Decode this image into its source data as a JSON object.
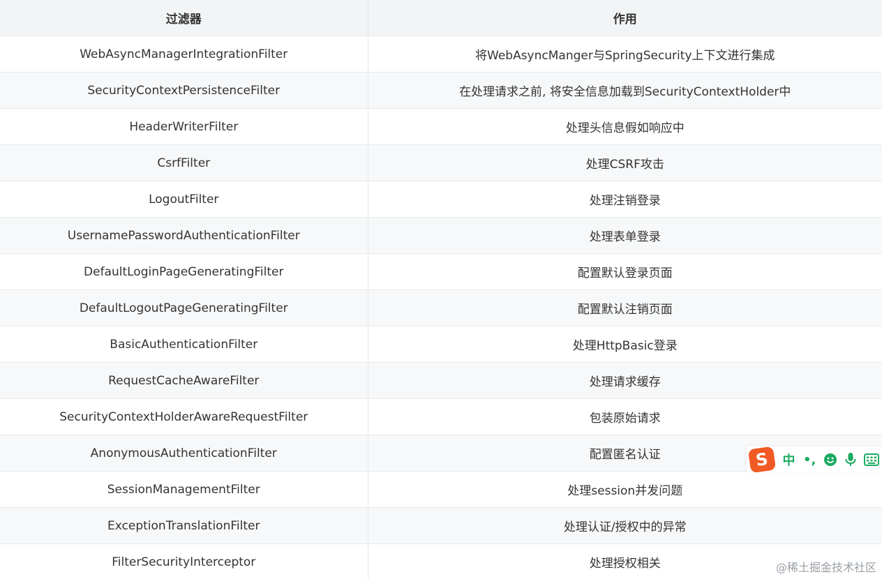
{
  "table": {
    "headers": [
      "过滤器",
      "作用"
    ],
    "rows": [
      [
        "WebAsyncManagerIntegrationFilter",
        "将WebAsyncManger与SpringSecurity上下文进行集成"
      ],
      [
        "SecurityContextPersistenceFilter",
        "在处理请求之前, 将安全信息加载到SecurityContextHolder中"
      ],
      [
        "HeaderWriterFilter",
        "处理头信息假如响应中"
      ],
      [
        "CsrfFilter",
        "处理CSRF攻击"
      ],
      [
        "LogoutFilter",
        "处理注销登录"
      ],
      [
        "UsernamePasswordAuthenticationFilter",
        "处理表单登录"
      ],
      [
        "DefaultLoginPageGeneratingFilter",
        "配置默认登录页面"
      ],
      [
        "DefaultLogoutPageGeneratingFilter",
        "配置默认注销页面"
      ],
      [
        "BasicAuthenticationFilter",
        "处理HttpBasic登录"
      ],
      [
        "RequestCacheAwareFilter",
        "处理请求缓存"
      ],
      [
        "SecurityContextHolderAwareRequestFilter",
        "包装原始请求"
      ],
      [
        "AnonymousAuthenticationFilter",
        "配置匿名认证"
      ],
      [
        "SessionManagementFilter",
        "处理session并发问题"
      ],
      [
        "ExceptionTranslationFilter",
        "处理认证/授权中的异常"
      ],
      [
        "FilterSecurityInterceptor",
        "处理授权相关"
      ]
    ]
  },
  "ime": {
    "logo_letter": "S",
    "mode_label": "中",
    "punct_label": "•,",
    "icons": [
      "emoji-icon",
      "microphone-icon",
      "keyboard-icon"
    ],
    "accent_color": "#1aab60",
    "logo_color": "#f15a24"
  },
  "watermark": "@稀土掘金技术社区"
}
